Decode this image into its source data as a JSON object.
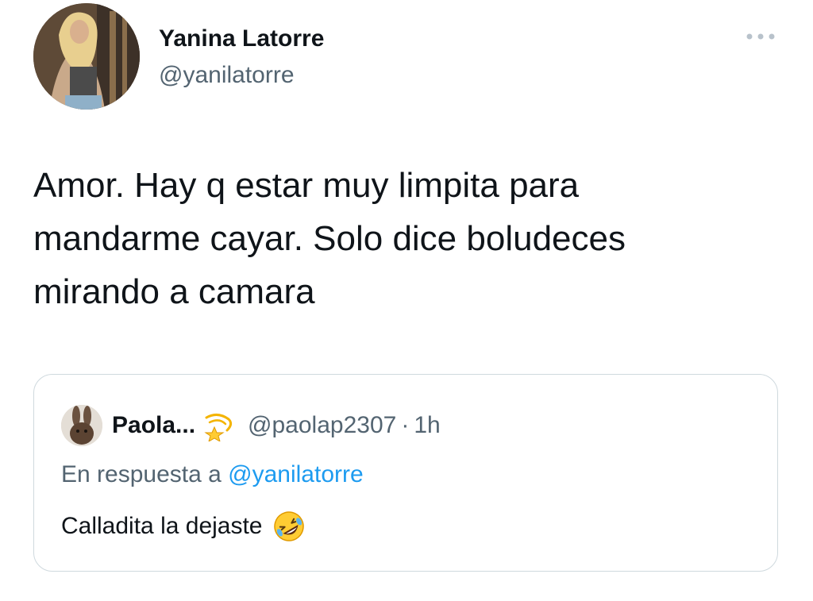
{
  "author": {
    "display_name": "Yanina Latorre",
    "handle": "@yanilatorre",
    "avatar_icon": "profile-photo"
  },
  "menu": {
    "icon": "more-horizontal-icon"
  },
  "tweet": {
    "text": "Amor. Hay q estar muy limpita para\nmandarme cayar. Solo dice boludeces\nmirando a camara"
  },
  "quoted_tweet": {
    "display_name": "Paola...",
    "name_emoji_icon": "dizzy-star-icon",
    "handle": "@paolap2307",
    "separator": "·",
    "time": "1h",
    "reply_prefix": "En respuesta a ",
    "reply_to": "@yanilatorre",
    "text": "Calladita la dejaste",
    "text_emoji_icon": "rolling-on-floor-laughing-icon",
    "avatar_icon": "rabbit-avatar"
  },
  "colors": {
    "text_primary": "#0f1419",
    "text_secondary": "#536471",
    "link": "#1d9bf0",
    "border": "#cfd9de"
  }
}
